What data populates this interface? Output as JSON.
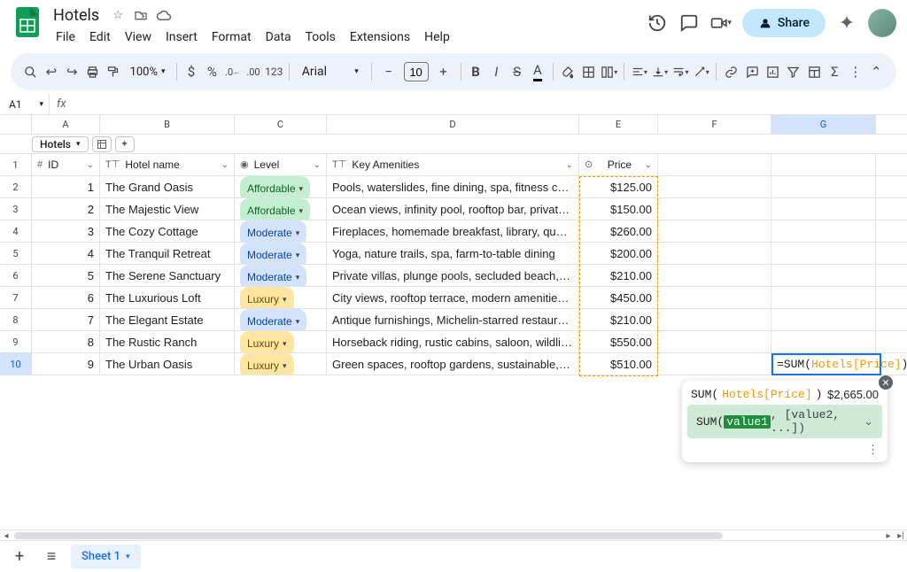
{
  "header": {
    "title": "Hotels",
    "menus": [
      "File",
      "Edit",
      "View",
      "Insert",
      "Format",
      "Data",
      "Tools",
      "Extensions",
      "Help"
    ],
    "share": "Share"
  },
  "toolbar": {
    "zoom": "100%",
    "font": "Arial",
    "font_size": "10"
  },
  "namebox": "A1",
  "table_chip": "Hotels",
  "columns": [
    "A",
    "B",
    "C",
    "D",
    "E",
    "F",
    "G"
  ],
  "active_col": "G",
  "headers": {
    "id": "ID",
    "name": "Hotel name",
    "level": "Level",
    "amen": "Key Amenities",
    "price": "Price"
  },
  "rows": [
    {
      "n": 1,
      "id": "1",
      "name": "The Grand Oasis",
      "level": "Affordable",
      "lvl": "afford",
      "amen": "Pools, waterslides, fine dining, spa, fitness center",
      "price": "$125.00"
    },
    {
      "n": 2,
      "id": "2",
      "name": "The Majestic View",
      "level": "Affordable",
      "lvl": "afford",
      "amen": "Ocean views, infinity pool, rooftop bar, private balconies",
      "price": "$150.00"
    },
    {
      "n": 3,
      "id": "3",
      "name": "The Cozy Cottage",
      "level": "Moderate",
      "lvl": "moderate",
      "amen": "Fireplaces, homemade breakfast, library, quaint village charm",
      "price": "$260.00"
    },
    {
      "n": 4,
      "id": "4",
      "name": "The Tranquil Retreat",
      "level": "Moderate",
      "lvl": "moderate",
      "amen": "Yoga, nature trails, spa, farm-to-table dining",
      "price": "$200.00"
    },
    {
      "n": 5,
      "id": "5",
      "name": "The Serene Sanctuary",
      "level": "Moderate",
      "lvl": "moderate",
      "amen": "Private villas, plunge pools, secluded beach, butler service",
      "price": "$210.00"
    },
    {
      "n": 6,
      "id": "6",
      "name": "The Luxurious Loft",
      "level": "Luxury",
      "lvl": "luxury",
      "amen": "City views, rooftop terrace, modern amenities, trendy bar",
      "price": "$450.00"
    },
    {
      "n": 7,
      "id": "7",
      "name": "The Elegant Estate",
      "level": "Moderate",
      "lvl": "moderate",
      "amen": "Antique furnishings, Michelin-starred restaurant, gardens",
      "price": "$210.00"
    },
    {
      "n": 8,
      "id": "8",
      "name": "The Rustic Ranch",
      "level": "Luxury",
      "lvl": "luxury",
      "amen": "Horseback riding, rustic cabins, saloon, wildlife viewing",
      "price": "$550.00"
    },
    {
      "n": 9,
      "id": "9",
      "name": "The Urban Oasis",
      "level": "Luxury",
      "lvl": "luxury",
      "amen": "Green spaces, rooftop gardens, sustainable, city views",
      "price": "$510.00"
    }
  ],
  "formula": {
    "eq": "=",
    "fn": "SUM",
    "open": "(",
    "ref": "Hotels[Price]",
    "close": ")"
  },
  "tooltip": {
    "fn": "SUM(",
    "ref": "Hotels[Price]",
    "close": ")",
    "result": "$2,665.00",
    "sig_fn": "SUM(",
    "sig_v1": "value1",
    "sig_rest": ", [value2, ...])"
  },
  "sheet_tab": "Sheet 1"
}
